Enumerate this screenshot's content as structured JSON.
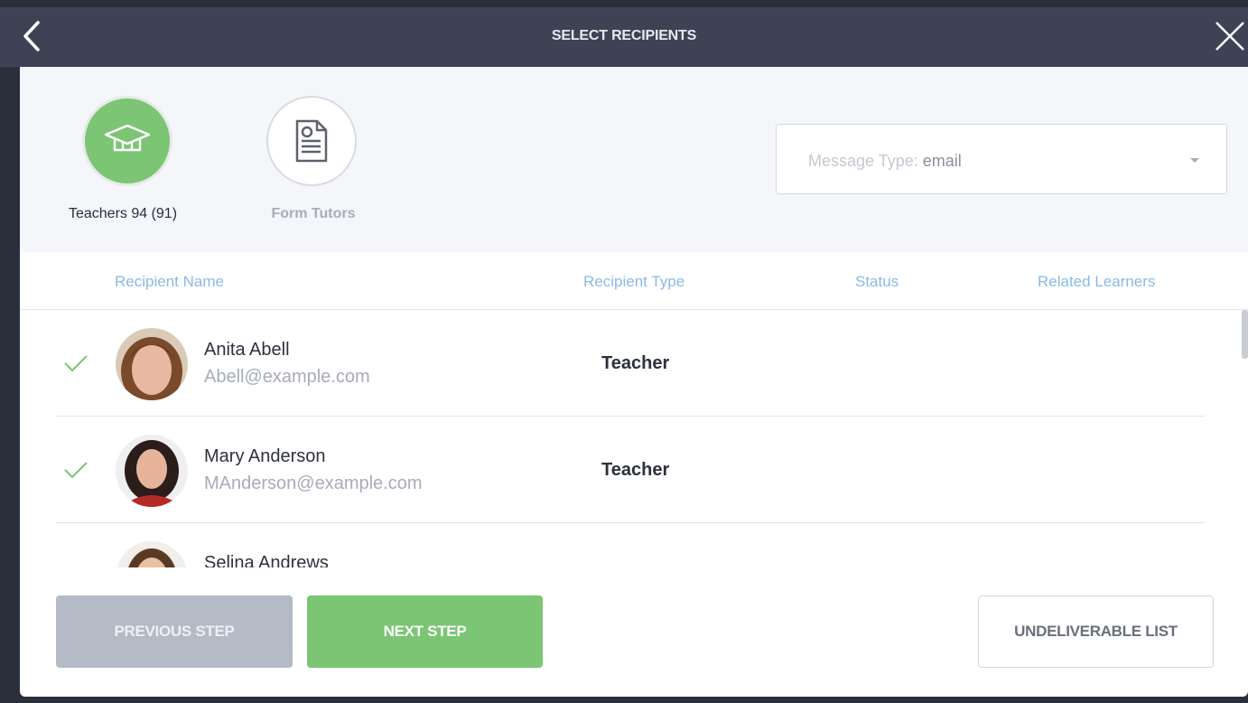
{
  "window": {
    "title": "SELECT RECIPIENTS",
    "back_icon": "chevron-left-icon",
    "close_icon": "close-icon"
  },
  "categories": [
    {
      "label": "Teachers 94 (91)",
      "icon": "graduation-cap-icon",
      "selected": true
    },
    {
      "label": "Form Tutors",
      "icon": "document-icon",
      "selected": false
    }
  ],
  "message_type": {
    "prefix": "Message Type: ",
    "value": "email"
  },
  "table": {
    "columns": [
      "Recipient Name",
      "Recipient Type",
      "Status",
      "Related Learners"
    ],
    "rows": [
      {
        "name": "Anita Abell",
        "email": "Abell@example.com",
        "type": "Teacher",
        "checked": true
      },
      {
        "name": "Mary Anderson",
        "email": "MAnderson@example.com",
        "type": "Teacher",
        "checked": true
      },
      {
        "name": "Selina Andrews",
        "email": "",
        "type": "",
        "checked": false
      }
    ]
  },
  "footer": {
    "previous_label": "PREVIOUS STEP",
    "next_label": "NEXT STEP",
    "undeliverable_label": "UNDELIVERABLE LIST"
  },
  "colors": {
    "accent_green": "#7bc574",
    "topbar": "#3d4354",
    "header_blue": "#8bb9e6",
    "disabled_button": "#b4bac6"
  }
}
